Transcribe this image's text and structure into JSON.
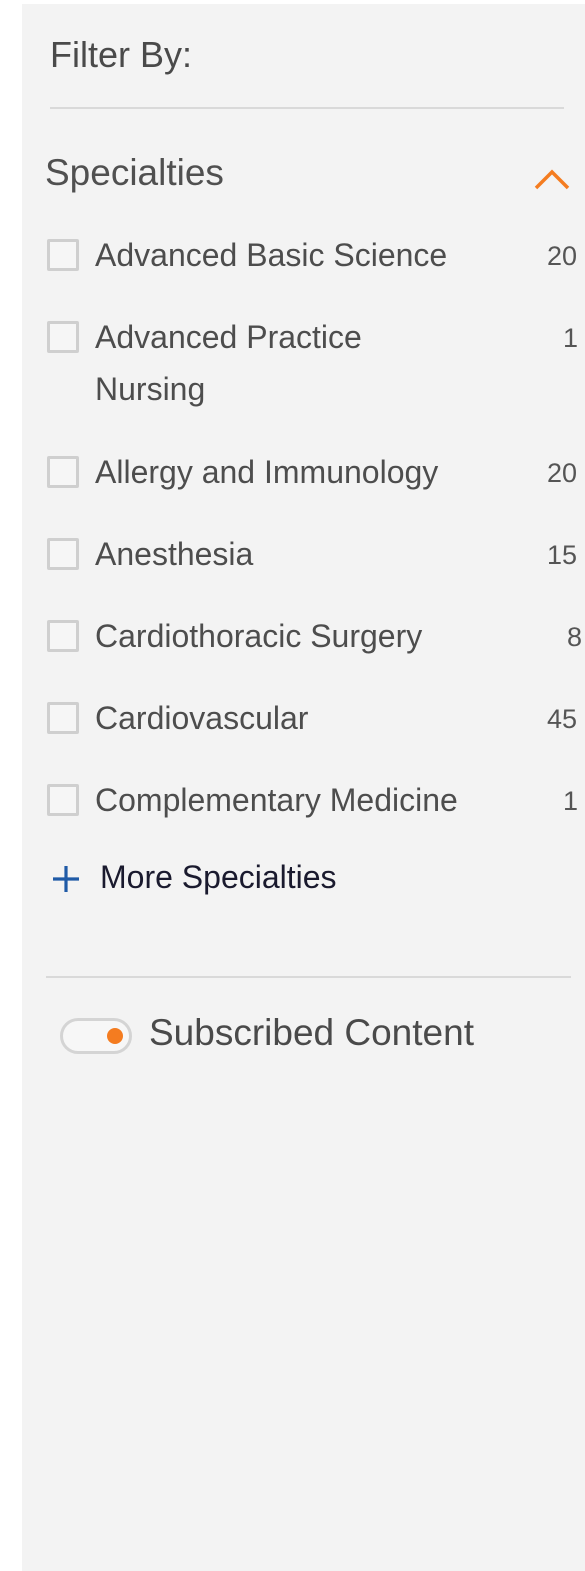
{
  "filter": {
    "title": "Filter By:"
  },
  "specialties": {
    "heading": "Specialties",
    "collapse_icon": "chevron-up-icon",
    "items": [
      {
        "label": "Advanced Basic Science",
        "count": "20",
        "checked": false
      },
      {
        "label": "Advanced Practice Nursing",
        "count": "1",
        "checked": false
      },
      {
        "label": "Allergy and Immunology",
        "count": "20",
        "checked": false
      },
      {
        "label": "Anesthesia",
        "count": "15",
        "checked": false
      },
      {
        "label": "Cardiothoracic Surgery",
        "count": "8",
        "checked": false
      },
      {
        "label": "Cardiovascular",
        "count": "45",
        "checked": false
      },
      {
        "label": "Complementary Medicine",
        "count": "1",
        "checked": false
      }
    ],
    "more_label": "More Specialties",
    "more_icon": "plus-icon"
  },
  "subscribed": {
    "label": "Subscribed Content",
    "toggle_on": true
  },
  "colors": {
    "panel_background": "#f3f3f3",
    "accent_orange": "#f47c20",
    "plus_blue": "#1f5aa6",
    "text_gray": "#4d4d4d"
  }
}
